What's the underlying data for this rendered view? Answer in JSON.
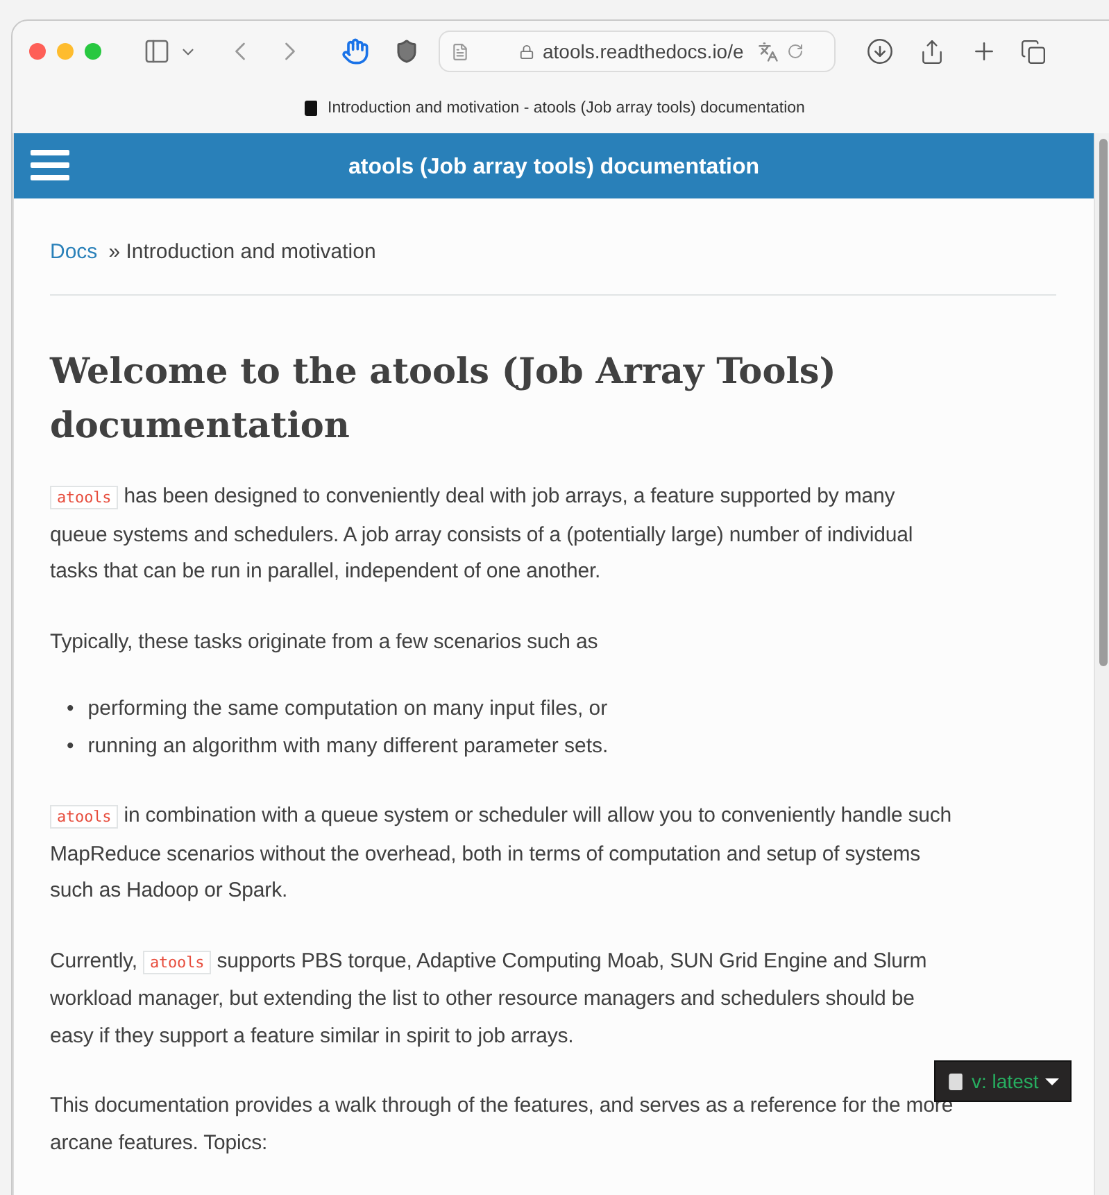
{
  "browser": {
    "url": "atools.readthedocs.io/e",
    "tab_title": "Introduction and motivation - atools (Job array tools) documentation"
  },
  "header": {
    "title": "atools (Job array tools) documentation"
  },
  "breadcrumb": {
    "link": "Docs",
    "current": "» Introduction and motivation"
  },
  "heading": "Welcome to the atools (Job Array Tools) documentation",
  "content": [
    {
      "kind": "paragraph",
      "parts": [
        {
          "kind": "code",
          "text": "atools"
        },
        {
          "kind": "text",
          "text": " has been designed to conveniently deal with job arrays, a feature supported by many queue systems and schedulers. A job array consists of a (potentially large) number of individual tasks that can be run in parallel, independent of one another."
        }
      ]
    },
    {
      "kind": "paragraph",
      "parts": [
        {
          "kind": "text",
          "text": "Typically, these tasks originate from a few scenarios such as"
        }
      ]
    },
    {
      "kind": "list",
      "items": [
        {
          "marker": "•",
          "text": "performing the same computation on many input files, or"
        },
        {
          "marker": "•",
          "text": "running an algorithm with many different parameter sets."
        }
      ]
    },
    {
      "kind": "paragraph",
      "parts": [
        {
          "kind": "code",
          "text": "atools"
        },
        {
          "kind": "text",
          "text": " in combination with a queue system or scheduler will allow you to conveniently handle such MapReduce scenarios without the overhead, both in terms of computation and setup of systems such as Hadoop or Spark."
        }
      ]
    },
    {
      "kind": "paragraph",
      "parts": [
        {
          "kind": "text",
          "text": "Currently, "
        },
        {
          "kind": "code",
          "text": "atools"
        },
        {
          "kind": "text",
          "text": " supports PBS torque, Adaptive Computing Moab, SUN Grid Engine and Slurm workload manager, but extending the list to other resource managers and schedulers should be easy if they support a feature similar in spirit to job arrays."
        }
      ]
    },
    {
      "kind": "paragraph",
      "parts": [
        {
          "kind": "text",
          "text": "This documentation provides a walk through of the features, and serves as a reference for the more arcane features. Topics:"
        }
      ]
    }
  ],
  "version_badge": {
    "label": "v: latest"
  }
}
